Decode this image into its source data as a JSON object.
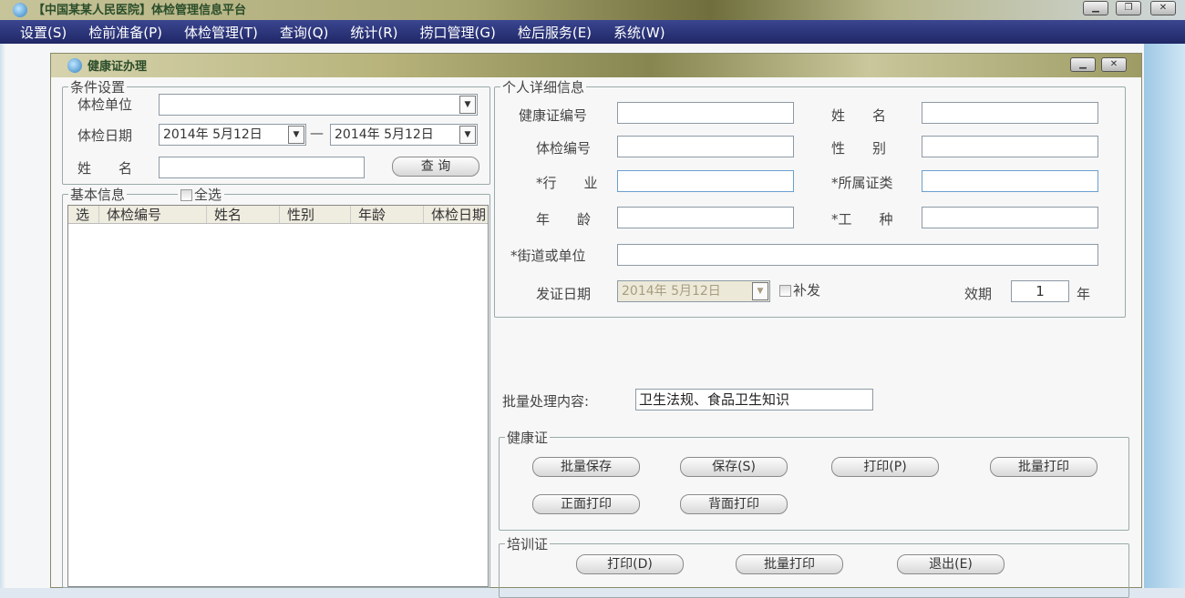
{
  "app": {
    "title": "【中国某某人民医院】体检管理信息平台"
  },
  "menu": [
    "设置(S)",
    "检前准备(P)",
    "体检管理(T)",
    "查询(Q)",
    "统计(R)",
    "捞口管理(G)",
    "检后服务(E)",
    "系统(W)"
  ],
  "window": {
    "title": "健康证办理"
  },
  "conditions": {
    "legend": "条件设置",
    "unit_label": "体检单位",
    "unit_value": "",
    "date_label": "体检日期",
    "date_from": "2014年 5月12日",
    "date_sep": "—",
    "date_to": "2014年 5月12日",
    "name_label": "姓　　名",
    "name_value": "",
    "query_button": "查 询"
  },
  "basic": {
    "legend": "基本信息",
    "select_all": "全选",
    "columns": [
      "选",
      "体检编号",
      "姓名",
      "性别",
      "年龄",
      "体检日期"
    ]
  },
  "detail": {
    "legend": "个人详细信息",
    "cert_no": "健康证编号",
    "name": "姓　　名",
    "exam_no": "体检编号",
    "gender": "性　　别",
    "industry": "*行　　业",
    "cert_type": "*所属证类",
    "age": "年　　龄",
    "job": "*工　　种",
    "street": "*街道或单位",
    "issue_date_label": "发证日期",
    "issue_date": "2014年 5月12日",
    "reissue": "补发",
    "validity_label": "效期",
    "validity_value": "1",
    "validity_unit": "年"
  },
  "batch": {
    "label": "批量处理内容:",
    "value": "卫生法规、食品卫生知识"
  },
  "health_cert": {
    "legend": "健康证",
    "buttons": [
      "批量保存",
      "保存(S)",
      "打印(P)",
      "批量打印",
      "正面打印",
      "背面打印"
    ]
  },
  "training_cert": {
    "legend": "培训证",
    "buttons": [
      "打印(D)",
      "批量打印",
      "退出(E)"
    ]
  }
}
